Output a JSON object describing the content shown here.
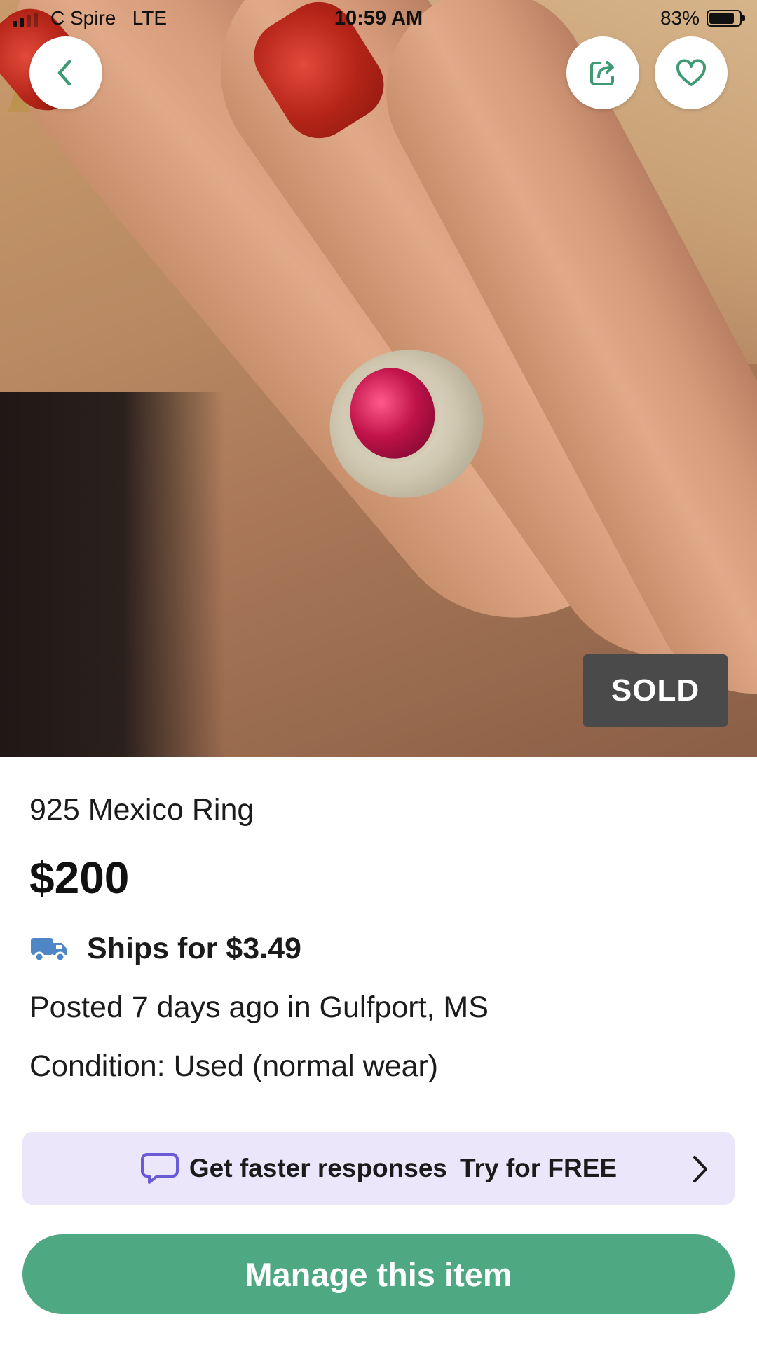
{
  "status_bar": {
    "carrier": "C Spire",
    "network": "LTE",
    "time": "10:59 AM",
    "battery_percent": "83%",
    "battery_level": 0.83
  },
  "listing": {
    "badge": "SOLD",
    "title": "925 Mexico Ring",
    "price": "$200",
    "shipping": "Ships for $3.49",
    "posted": "Posted 7 days ago in Gulfport, MS",
    "condition": "Condition: Used (normal wear)"
  },
  "promo": {
    "lead": "Get faster responses",
    "cta": "Try for FREE"
  },
  "actions": {
    "manage_label": "Manage this item"
  },
  "icons": {
    "back": "chevron-left-icon",
    "share": "share-icon",
    "favorite": "heart-icon",
    "shipping": "truck-icon",
    "chat": "chat-bubble-icon",
    "promo_arrow": "chevron-right-icon"
  },
  "colors": {
    "accent": "#4ea882",
    "icon_green": "#3f9a74",
    "promo_bg": "#ebe6fa",
    "promo_icon": "#6a5ad6",
    "badge_bg": "#4a4a4a",
    "truck": "#4f86c6"
  }
}
